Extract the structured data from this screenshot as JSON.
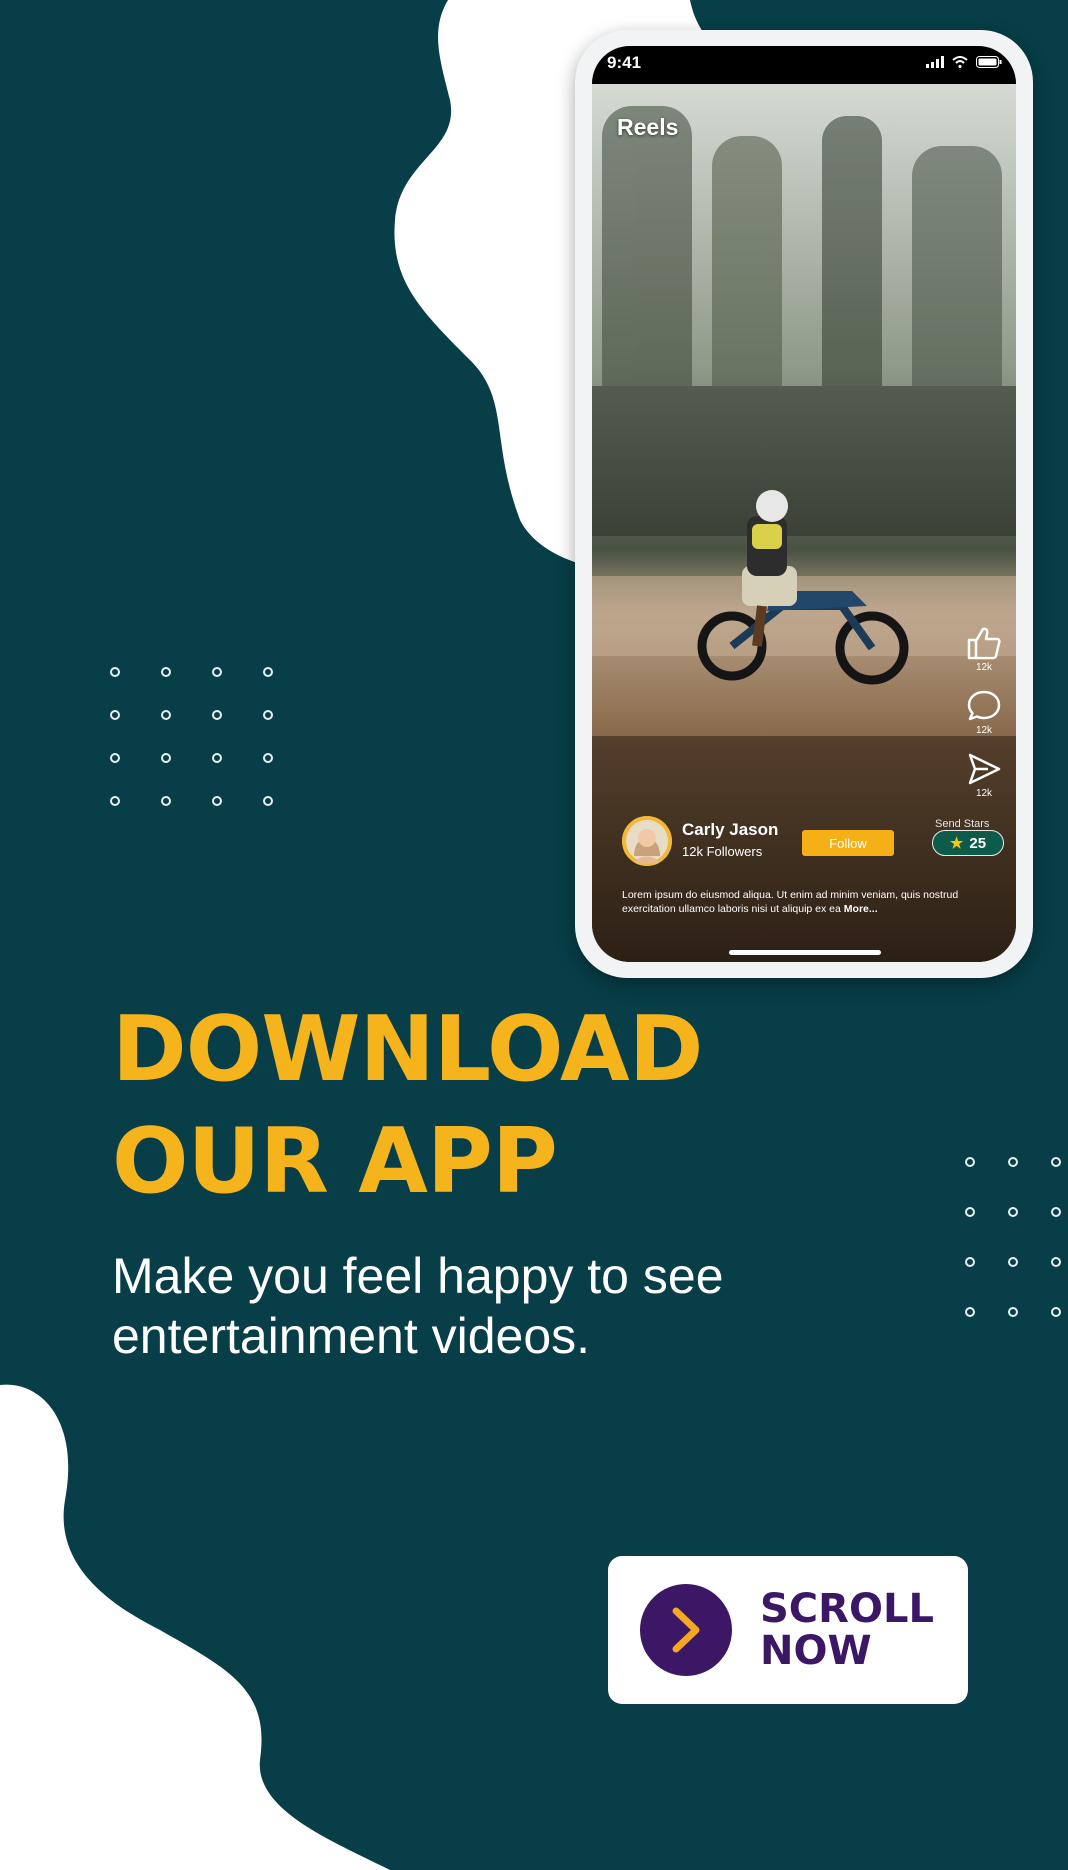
{
  "colors": {
    "background": "#073e47",
    "accent_yellow": "#f5b41c",
    "cta_purple": "#3b1766",
    "follow_orange": "#f5b017",
    "stars_green": "#0e5b4b"
  },
  "phone": {
    "status_time": "9:41",
    "status_icons": [
      "signal-icon",
      "wifi-icon",
      "battery-icon"
    ],
    "reels_title": "Reels",
    "actions": [
      {
        "icon": "thumbs-up-icon",
        "count": "12k"
      },
      {
        "icon": "comment-icon",
        "count": "12k"
      },
      {
        "icon": "send-icon",
        "count": "12k"
      }
    ],
    "creator": {
      "name": "Carly Jason",
      "followers": "12k Followers",
      "follow_label": "Follow",
      "send_stars_label": "Send Stars",
      "stars_count": "25"
    },
    "caption": "Lorem ipsum do eiusmod aliqua. Ut enim ad minim veniam, quis nostrud exercitation ullamco laboris nisi ut aliquip ex ea",
    "more_label": "More..."
  },
  "headline": {
    "line1": "DOWNLOAD",
    "line2": "OUR APP"
  },
  "subtext": {
    "line1": "Make you feel happy to see",
    "line2": "entertainment videos."
  },
  "cta": {
    "icon": "chevron-right-icon",
    "line1": "SCROLL",
    "line2": "NOW"
  }
}
